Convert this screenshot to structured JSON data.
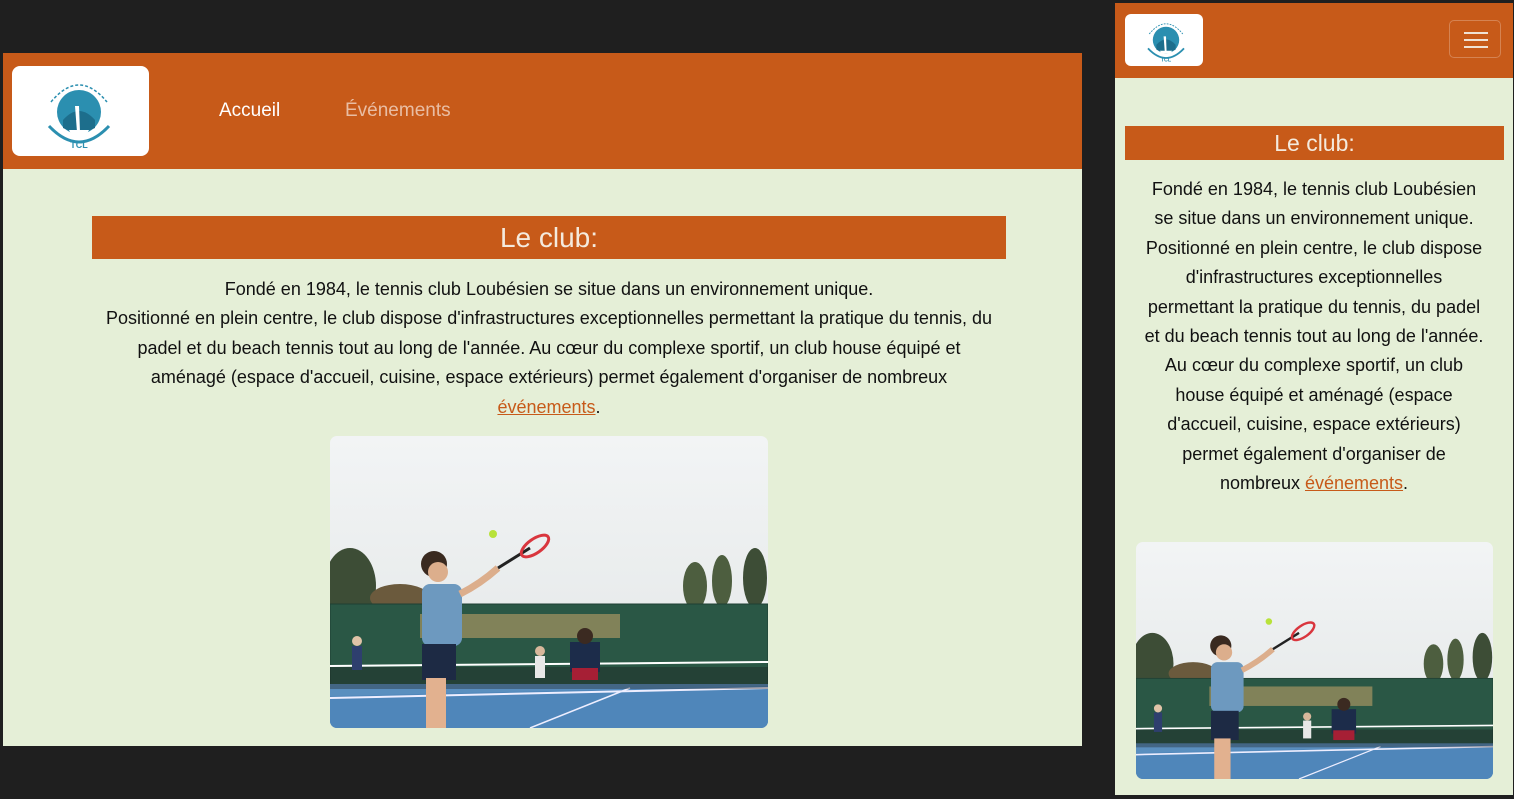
{
  "nav": {
    "home_label": "Accueil",
    "events_label": "Événements",
    "logo_text": "TENNIS CLUB LOUBÉSIEN",
    "logo_abbrev": "TCL"
  },
  "club": {
    "title": "Le club:",
    "line1": "Fondé en 1984, le tennis club Loubésien se situe dans un environnement unique.",
    "line2_before_link": "Positionné en plein centre, le club dispose d'infrastructures exceptionnelles permettant la pratique du tennis, du padel et du beach tennis tout au long de l'année. Au cœur du complexe sportif, un club house équipé et aménagé (espace d'accueil, cuisine, espace extérieurs) permet également d'organiser de nombreux ",
    "link_text": "événements",
    "after_link": "."
  },
  "colors": {
    "brand": "#c75a19",
    "background": "#e5efd7",
    "frame": "#1f1f1f"
  },
  "icons": {
    "menu": "hamburger-icon",
    "logo": "tennis-club-logo"
  }
}
